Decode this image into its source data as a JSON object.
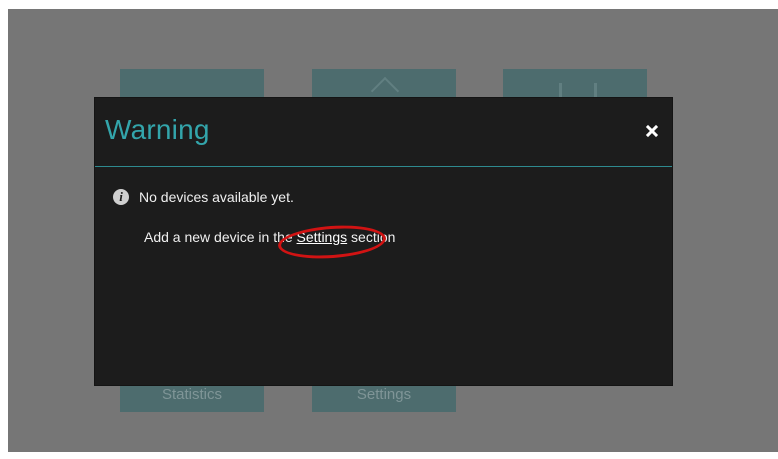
{
  "background": {
    "tiles": [
      {
        "label": ""
      },
      {
        "label": ""
      },
      {
        "label": ""
      }
    ],
    "bottom_labels": [
      "Statistics",
      "Settings"
    ]
  },
  "dialog": {
    "title": "Warning",
    "close_icon": "close-icon",
    "info_icon": "info-icon",
    "message": "No devices available yet.",
    "help_prefix": "Add a new device in the ",
    "help_link": "Settings",
    "help_suffix": " section"
  },
  "colors": {
    "overlay": "#767676",
    "tile": "#4d6c6e",
    "dialog_bg": "#1c1c1c",
    "title": "#33a5ab",
    "divider": "#2e8a8f",
    "annotation": "#d11313"
  }
}
